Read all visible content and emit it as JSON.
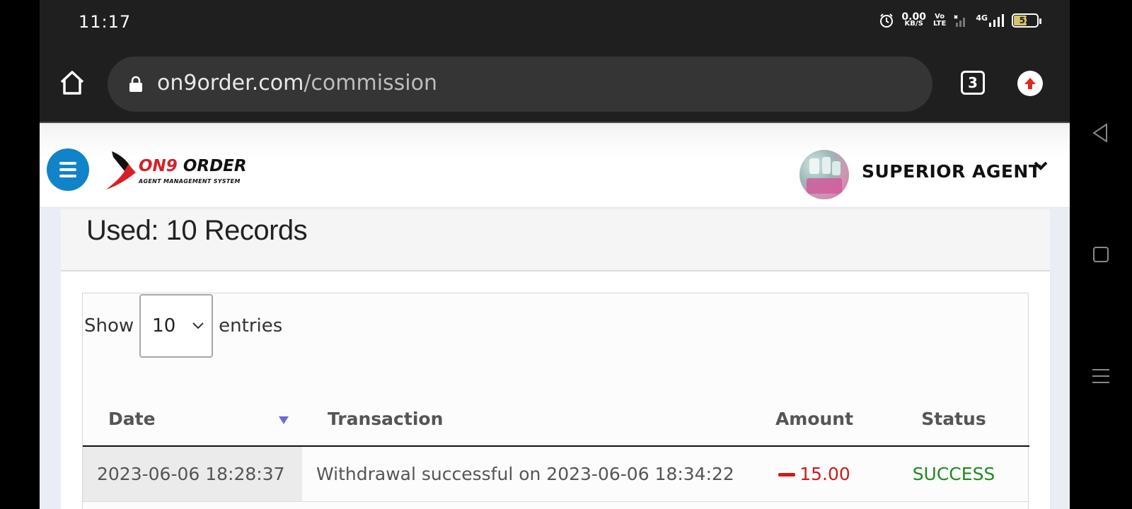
{
  "status_bar": {
    "time": "11:17",
    "net_speed": "0.00",
    "net_speed_unit": "KB/S",
    "volte": [
      "Vo",
      "LTE"
    ],
    "network": "4G",
    "battery": "52"
  },
  "browser": {
    "url_domain": "on9order.com",
    "url_path": "/commission",
    "tab_count": "3"
  },
  "app_header": {
    "logo_name_red": "ON9",
    "logo_name_dark": " ORDER",
    "logo_subtitle": "AGENT MANAGEMENT SYSTEM",
    "user_name": "SUPERIOR AGENT"
  },
  "card": {
    "title": "Used: 10 Records"
  },
  "table_controls": {
    "show_label": "Show",
    "page_length": "10",
    "entries_label": "entries"
  },
  "table": {
    "headers": [
      "Date",
      "Transaction",
      "Amount",
      "Status"
    ],
    "rows": [
      {
        "date": "2023-06-06 18:28:37",
        "transaction": "Withdrawal successful on 2023-06-06 18:34:22",
        "amount": "15.00",
        "status": "SUCCESS"
      }
    ]
  },
  "colors": {
    "menu_button": "#1183c8",
    "brand_red": "#d81f26",
    "amount_negative": "#d11a1a",
    "status_success": "#1e8a1e",
    "sort_indicator": "#6b6bd6"
  },
  "icons": {
    "status": [
      "alarm-icon",
      "signal-icon",
      "battery-icon"
    ],
    "browser": [
      "home-icon",
      "lock-icon",
      "tabs-icon",
      "update-icon"
    ],
    "nav": [
      "back-icon",
      "home-square-icon",
      "recents-icon"
    ]
  }
}
